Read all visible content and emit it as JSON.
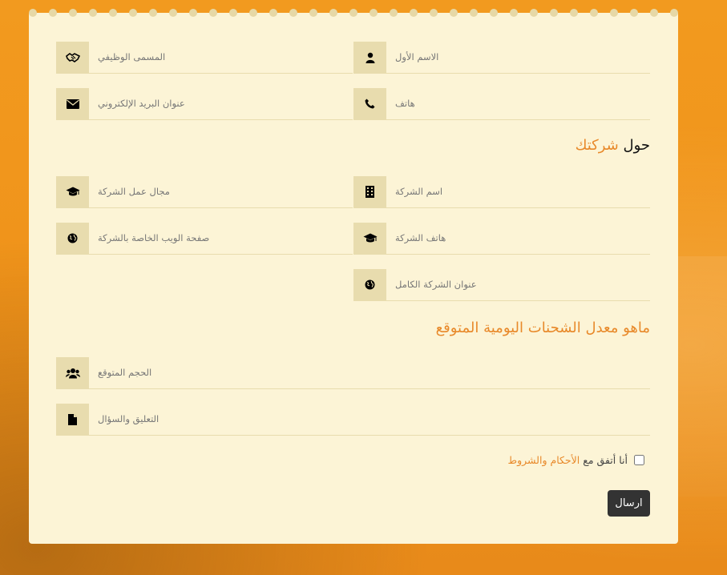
{
  "personal": {
    "job_title": "المسمى الوظيفي",
    "first_name": "الاسم الأول",
    "email": "عنوان البريد الإلكتروني",
    "phone": "هاتف"
  },
  "company_section": {
    "title_prefix": "حول",
    "title_accent": "شركتك",
    "industry": "مجال عمل الشركة",
    "company_name": "اسم الشركة",
    "website": "صفحة الويب الخاصة بالشركة",
    "company_phone": "هاتف الشركة",
    "full_address": "عنوان الشركة الكامل"
  },
  "shipments_section": {
    "title": "ماهو معدل الشحنات اليومية المتوقع",
    "expected_volume": "الحجم المتوقع",
    "comments": "التعليق والسؤال"
  },
  "agreement": {
    "text": "أنا أتفق مع",
    "link": "الأحكام والشروط"
  },
  "submit_label": "ارسال"
}
